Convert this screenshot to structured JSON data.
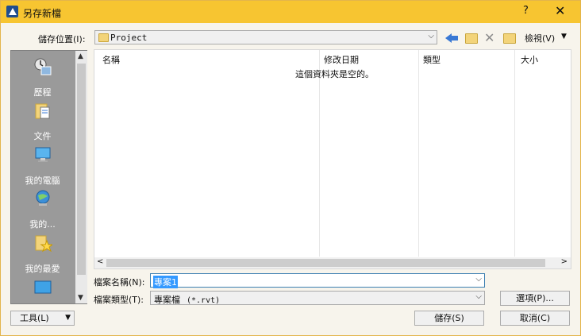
{
  "window": {
    "title": "另存新檔",
    "help": "?",
    "close": "✕"
  },
  "toolbar": {
    "save_in_label": "儲存位置(I):",
    "location": "Project",
    "view_label": "檢視(V)"
  },
  "places": [
    {
      "label": "歷程",
      "icon": "history-icon"
    },
    {
      "label": "文件",
      "icon": "documents-icon"
    },
    {
      "label": "我的電腦",
      "icon": "my-computer-icon"
    },
    {
      "label": "我的...",
      "icon": "network-icon"
    },
    {
      "label": "我的最愛",
      "icon": "favorites-icon"
    }
  ],
  "file_list": {
    "columns": [
      "名稱",
      "修改日期",
      "類型",
      "大小"
    ],
    "empty_message": "這個資料夾是空的。"
  },
  "form": {
    "filename_label": "檔案名稱(N):",
    "filename_value": "專案1",
    "filetype_label": "檔案類型(T):",
    "filetype_value": "專案檔",
    "filetype_ext": "(*.rvt)"
  },
  "buttons": {
    "tools": "工具(L)",
    "options": "選項(P)...",
    "save": "儲存(S)",
    "cancel": "取消(C)"
  },
  "colors": {
    "title_bar": "#f7c531",
    "places_bar": "#9a9a9a",
    "selection": "#3399ff"
  }
}
